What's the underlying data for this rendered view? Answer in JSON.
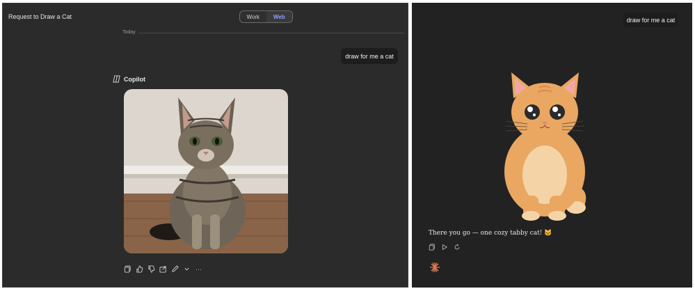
{
  "left": {
    "window_title": "Request to Draw a Cat",
    "mode_toggle": {
      "options": [
        "Work",
        "Web"
      ],
      "selected": "Web"
    },
    "date_label": "Today",
    "user_message": "draw for me a cat",
    "assistant_name": "Copilot",
    "image_alt": "Photo of a tabby cat sitting on a wooden floor",
    "actions": [
      "copy-icon",
      "thumbs-up-icon",
      "thumbs-down-icon",
      "share-icon",
      "edit-icon",
      "chevron-down-icon",
      "more-icon"
    ],
    "more_label": "···"
  },
  "right": {
    "user_message": "draw for me a cat",
    "reply_text": "There you go — one cozy tabby cat! 🐱",
    "actions": [
      "copy-icon",
      "play-icon",
      "refresh-icon"
    ],
    "logo_icon": "spark-icon"
  },
  "colors": {
    "accent": "#8ea0ff",
    "cat_orange": "#e9a762",
    "cat_belly": "#f4d4a6"
  }
}
